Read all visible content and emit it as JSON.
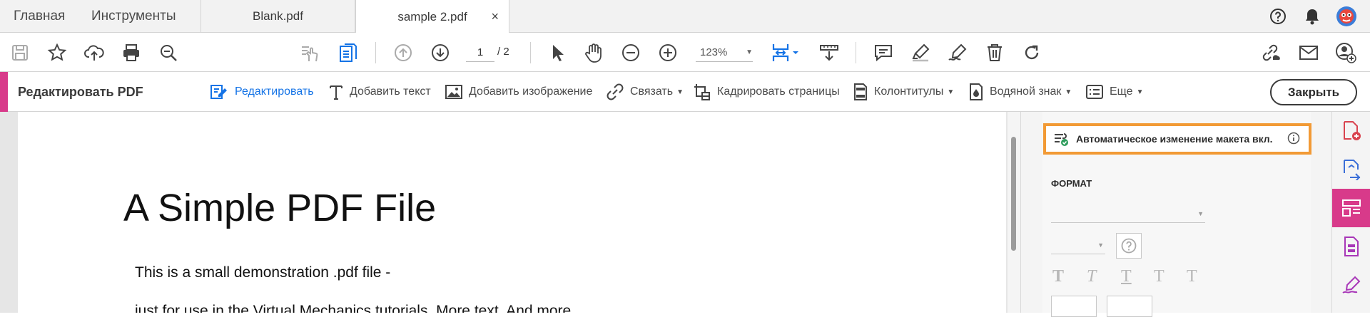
{
  "tabs": {
    "home": "Главная",
    "tools": "Инструменты",
    "documents": [
      {
        "name": "Blank.pdf",
        "active": false
      },
      {
        "name": "sample 2.pdf",
        "active": true
      }
    ],
    "close_symbol": "×"
  },
  "toolbar": {
    "page_current": "1",
    "page_total": "/ 2",
    "zoom": "123%"
  },
  "edit_toolbar": {
    "title": "Редактировать PDF",
    "edit": "Редактировать",
    "add_text": "Добавить текст",
    "add_image": "Добавить изображение",
    "link": "Связать",
    "crop": "Кадрировать страницы",
    "header_footer": "Колонтитулы",
    "watermark": "Водяной знак",
    "more": "Еще",
    "close": "Закрыть"
  },
  "document": {
    "title": "A Simple PDF File",
    "line1": "This is a small demonstration .pdf file -",
    "line2": "just for use in the Virtual Mechanics tutorials. More text. And more"
  },
  "panel": {
    "reflow_label": "Автоматическое изменение макета вкл.",
    "format_label": "ФОРМАТ",
    "text_styles": [
      "T",
      "T",
      "T",
      "T",
      "T"
    ]
  },
  "colors": {
    "accent": "#d83a8a",
    "highlight_border": "#f29a35",
    "active_blue": "#1473e6"
  }
}
